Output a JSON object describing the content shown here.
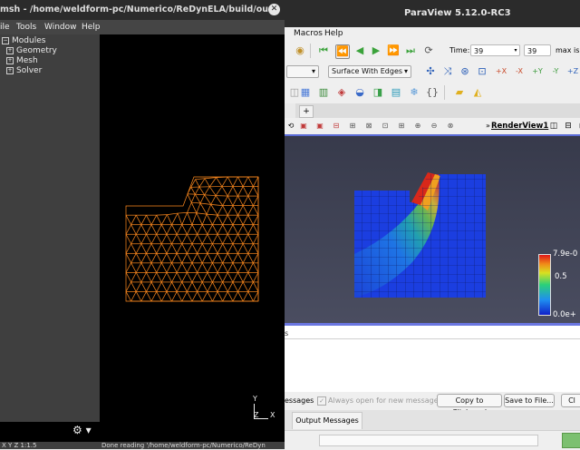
{
  "gmsh": {
    "title": "msh - /home/weldform-pc/Numerico/ReDynELA/build/ou...",
    "close_glyph": "✕",
    "menu": [
      "ile",
      "Tools",
      "Window",
      "Help"
    ],
    "tree": [
      {
        "label": "Modules",
        "box": "−"
      },
      {
        "label": "Geometry",
        "box": "+"
      },
      {
        "label": "Mesh",
        "box": "+"
      },
      {
        "label": "Solver",
        "box": "+"
      }
    ],
    "gear_label": "⚙ ▾",
    "axes": {
      "y": "Y",
      "z": "Z",
      "x": "X"
    },
    "status_left": "X Y Z 1:1.5",
    "status_right": "Done reading '/home/weldform-pc/Numerico/ReDyn"
  },
  "paraview": {
    "title": "ParaView 5.12.0-RC3",
    "menu": [
      "Macros",
      "Help"
    ],
    "time_label": "Time:",
    "time_value": "39",
    "step_value": "39",
    "max_label": "max is",
    "representation": "Surface With Edges",
    "tab_plus": "+",
    "view_title": "RenderView1",
    "view_prefix": "»",
    "colorbar": {
      "max_label": "7.9e-0",
      "mid_label": "0.5",
      "min_label": "0.0e+"
    },
    "output": {
      "messages_label": "essages",
      "always_open_label": "Always open for new messages",
      "copy_button": "Copy to Clipboard",
      "save_button": "Save to File...",
      "clear_button": "Cl",
      "tab_label": "Output Messages",
      "side_label": "s"
    },
    "colors": {
      "accent": "#5a6bd6",
      "mesh": "#ff8a1e"
    }
  }
}
